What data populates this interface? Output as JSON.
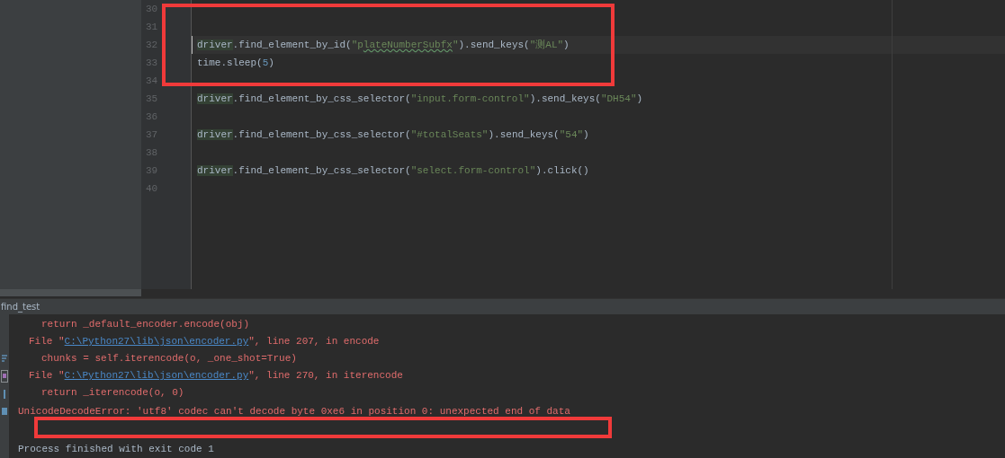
{
  "editor": {
    "lines": [
      {
        "number": "30"
      },
      {
        "number": "31"
      },
      {
        "number": "32",
        "current": true,
        "tokens": [
          {
            "kind": "ref",
            "text": "driver"
          },
          {
            "kind": "plain",
            "text": ".find_element_by_id("
          },
          {
            "kind": "string",
            "text": "\"p"
          },
          {
            "kind": "typo",
            "text": "lateNumberSubfx"
          },
          {
            "kind": "string",
            "text": "\""
          },
          {
            "kind": "plain",
            "text": ").send_keys("
          },
          {
            "kind": "string",
            "text": "\"测AL\""
          },
          {
            "kind": "plain",
            "text": ")"
          }
        ]
      },
      {
        "number": "33",
        "tokens": [
          {
            "kind": "plain",
            "text": "time.sleep("
          },
          {
            "kind": "number",
            "text": "5"
          },
          {
            "kind": "plain",
            "text": ")"
          }
        ]
      },
      {
        "number": "34"
      },
      {
        "number": "35",
        "tokens": [
          {
            "kind": "ref",
            "text": "driver"
          },
          {
            "kind": "plain",
            "text": ".find_element_by_css_selector("
          },
          {
            "kind": "string",
            "text": "\"input.form-control\""
          },
          {
            "kind": "plain",
            "text": ").send_keys("
          },
          {
            "kind": "string",
            "text": "\"DH54\""
          },
          {
            "kind": "plain",
            "text": ")"
          }
        ]
      },
      {
        "number": "36"
      },
      {
        "number": "37",
        "tokens": [
          {
            "kind": "ref",
            "text": "driver"
          },
          {
            "kind": "plain",
            "text": ".find_element_by_css_selector("
          },
          {
            "kind": "string",
            "text": "\"#totalSeats\""
          },
          {
            "kind": "plain",
            "text": ").send_keys("
          },
          {
            "kind": "string",
            "text": "\"54\""
          },
          {
            "kind": "plain",
            "text": ")"
          }
        ]
      },
      {
        "number": "38"
      },
      {
        "number": "39",
        "tokens": [
          {
            "kind": "ref",
            "text": "driver"
          },
          {
            "kind": "plain",
            "text": ".find_element_by_css_selector("
          },
          {
            "kind": "string",
            "text": "\"select.form-control\""
          },
          {
            "kind": "plain",
            "text": ").click()"
          }
        ]
      },
      {
        "number": "40"
      }
    ]
  },
  "run_panel": {
    "title": "find_test",
    "lines": [
      {
        "kind": "source",
        "parts": [
          {
            "kind": "text",
            "text": "return _default_encoder.encode(obj)"
          }
        ]
      },
      {
        "kind": "frame",
        "parts": [
          {
            "kind": "text",
            "text": "File \""
          },
          {
            "kind": "link",
            "text": "C:\\Python27\\lib\\json\\encoder.py"
          },
          {
            "kind": "text",
            "text": "\", line 207, in encode"
          }
        ]
      },
      {
        "kind": "source",
        "parts": [
          {
            "kind": "text",
            "text": "chunks = self.iterencode(o, _one_shot=True)"
          }
        ]
      },
      {
        "kind": "frame",
        "parts": [
          {
            "kind": "text",
            "text": "File \""
          },
          {
            "kind": "link",
            "text": "C:\\Python27\\lib\\json\\encoder.py"
          },
          {
            "kind": "text",
            "text": "\", line 270, in iterencode"
          }
        ]
      },
      {
        "kind": "source",
        "parts": [
          {
            "kind": "text",
            "text": "return _iterencode(o, 0)"
          }
        ]
      },
      {
        "kind": "error",
        "parts": [
          {
            "kind": "text",
            "text": "UnicodeDecodeError: 'utf8' codec can't decode byte 0xe6 in position 0: unexpected end of data"
          }
        ]
      },
      {
        "kind": "blank"
      },
      {
        "kind": "info",
        "parts": [
          {
            "kind": "text",
            "text": "Process finished with exit code 1"
          }
        ]
      }
    ]
  }
}
